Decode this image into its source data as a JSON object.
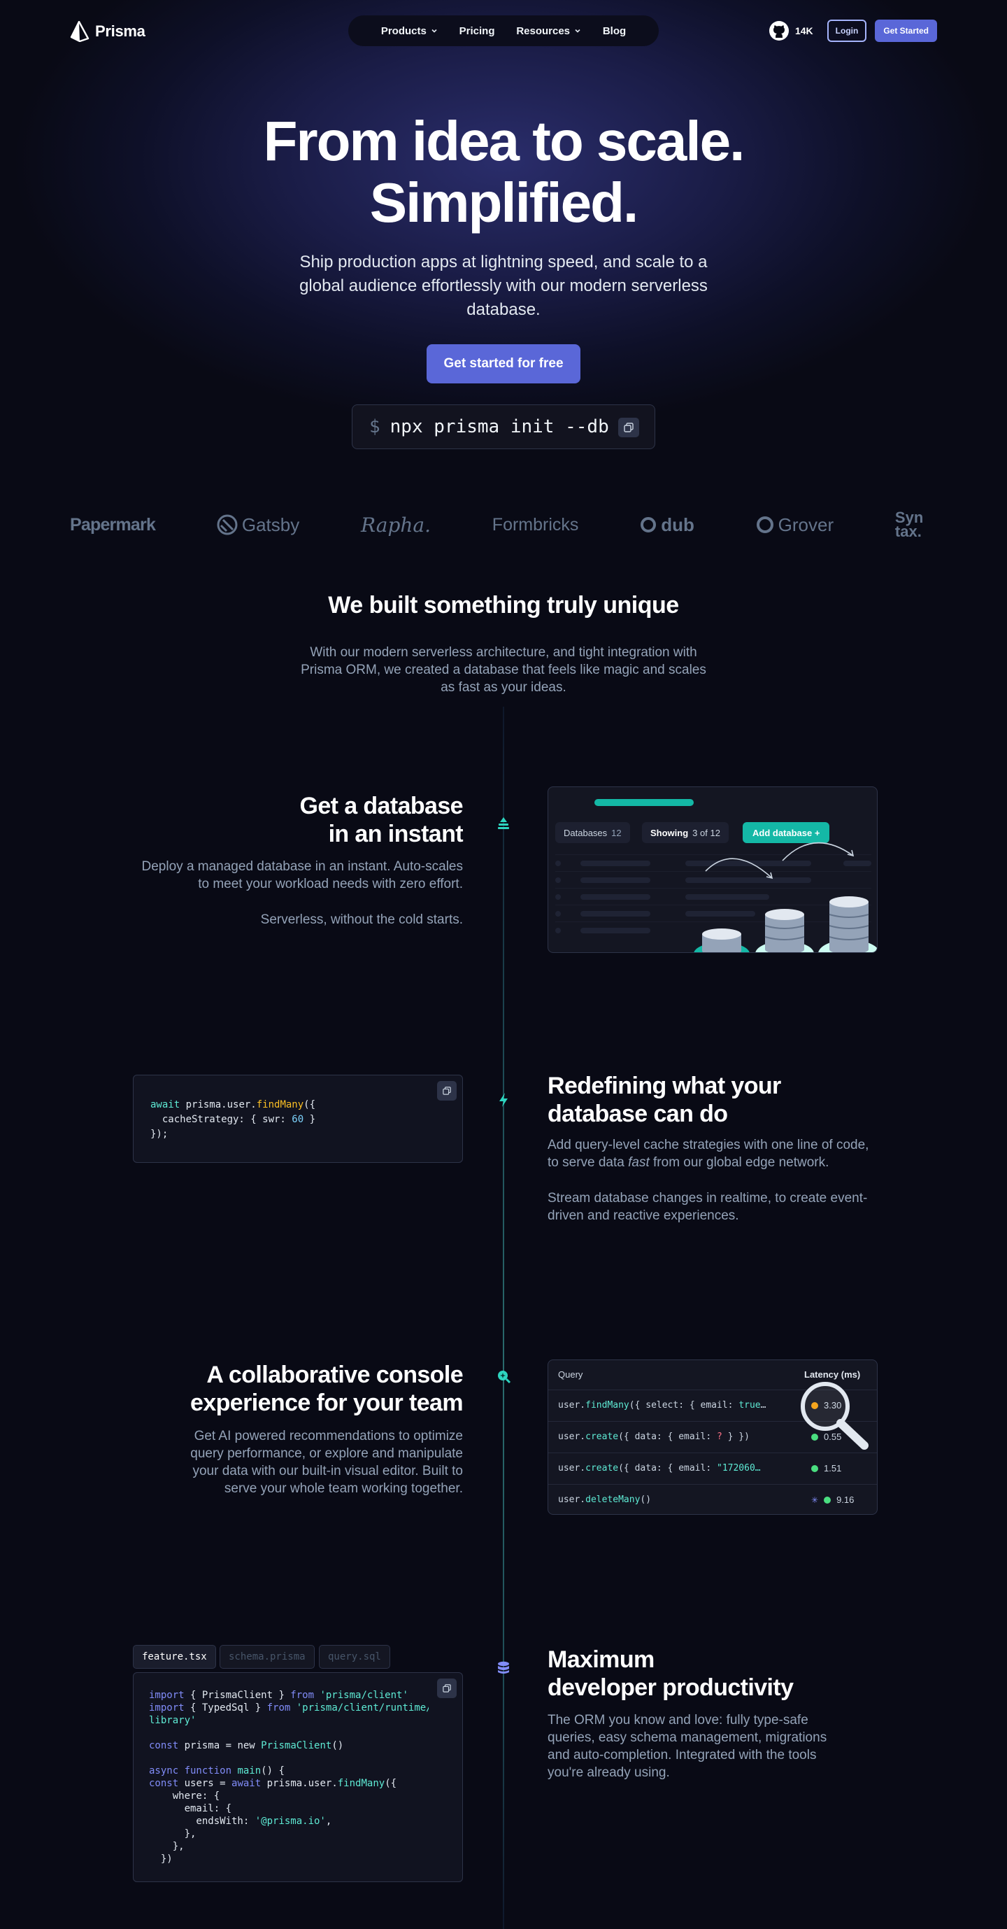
{
  "nav": {
    "logo": "Prisma",
    "items": [
      {
        "label": "Products",
        "dropdown": true
      },
      {
        "label": "Pricing",
        "dropdown": false
      },
      {
        "label": "Resources",
        "dropdown": true
      },
      {
        "label": "Blog",
        "dropdown": false
      }
    ],
    "github_stars": "14K",
    "login": "Login",
    "get_started": "Get Started"
  },
  "hero": {
    "title_line1": "From idea to scale.",
    "title_line2": "Simplified.",
    "subtitle": "Ship production apps at lightning speed, and scale to a global audience effortlessly with our modern serverless database.",
    "cta": "Get started for free",
    "command_prompt": "$",
    "command": "npx prisma init --db"
  },
  "logos": [
    "Papermark",
    "Gatsby",
    "Rapha.",
    "Formbricks",
    "dub",
    "Grover",
    "Syn tax."
  ],
  "unique": {
    "title": "We built something truly unique",
    "subtitle": "With our modern serverless architecture, and tight integration with Prisma ORM, we created a database that feels like magic and scales as fast as your ideas."
  },
  "features": {
    "instant": {
      "title_line1": "Get a database",
      "title_line2": "in an instant",
      "text1": "Deploy a managed database in an instant. Auto-scales to meet your workload needs with zero effort.",
      "text2": "Serverless, without the cold starts.",
      "card": {
        "databases_label": "Databases",
        "databases_count": "12",
        "showing_label": "Showing",
        "showing_value": "3 of 12",
        "add_button": "Add database +"
      }
    },
    "redefining": {
      "title_line1": "Redefining what your",
      "title_line2": "database can do",
      "text1_a": "Add query-level cache strategies with one line of code, to serve data ",
      "text1_em": "fast",
      "text1_b": " from our global edge network.",
      "text2": "Stream database changes in realtime, to create event-driven and reactive experiences.",
      "code": {
        "l1_await": "await",
        "l1_obj": " prisma.user.",
        "l1_fn": "findMany",
        "l1_end": "({",
        "l2_key": "  cacheStrategy: { swr: ",
        "l2_num": "60",
        "l2_end": " }",
        "l3": "});"
      }
    },
    "console": {
      "title_line1": "A collaborative console",
      "title_line2": "experience for your team",
      "text": "Get AI powered recommendations to optimize query performance, or explore and manipulate your data with our built-in visual editor. Built to serve your whole team working together.",
      "table": {
        "col_query": "Query",
        "col_latency": "Latency (ms)",
        "rows": [
          {
            "obj": "user.",
            "fn": "findMany",
            "args": "({ select: { email: ",
            "args_hl": "true",
            "args_end": "…",
            "latency": "3.30",
            "status": "#f59e0b"
          },
          {
            "obj": "user.",
            "fn": "create",
            "args": "({ data: { email: ",
            "args_hl": "?",
            "args_end": " } })",
            "latency": "0.55",
            "status": "#4ade80"
          },
          {
            "obj": "user.",
            "fn": "create",
            "args": "({ data: { email: ",
            "args_hl": "\"172060…",
            "args_end": "",
            "latency": "1.51",
            "status": "#4ade80"
          },
          {
            "obj": "user.",
            "fn": "deleteMany",
            "args": "()",
            "args_hl": "",
            "args_end": "",
            "latency": "9.16",
            "status": "#4ade80"
          }
        ]
      }
    },
    "productivity": {
      "title_line1": "Maximum",
      "title_line2": "developer productivity",
      "text": "The ORM you know and love: fully type-safe queries, easy schema management, migrations and auto-completion. Integrated with the tools you're already using.",
      "tabs": [
        "feature.tsx",
        "schema.prisma",
        "query.sql"
      ]
    }
  },
  "colors": {
    "accent": "#5a67d8",
    "teal": "#14b8a6",
    "background": "#090a15"
  }
}
